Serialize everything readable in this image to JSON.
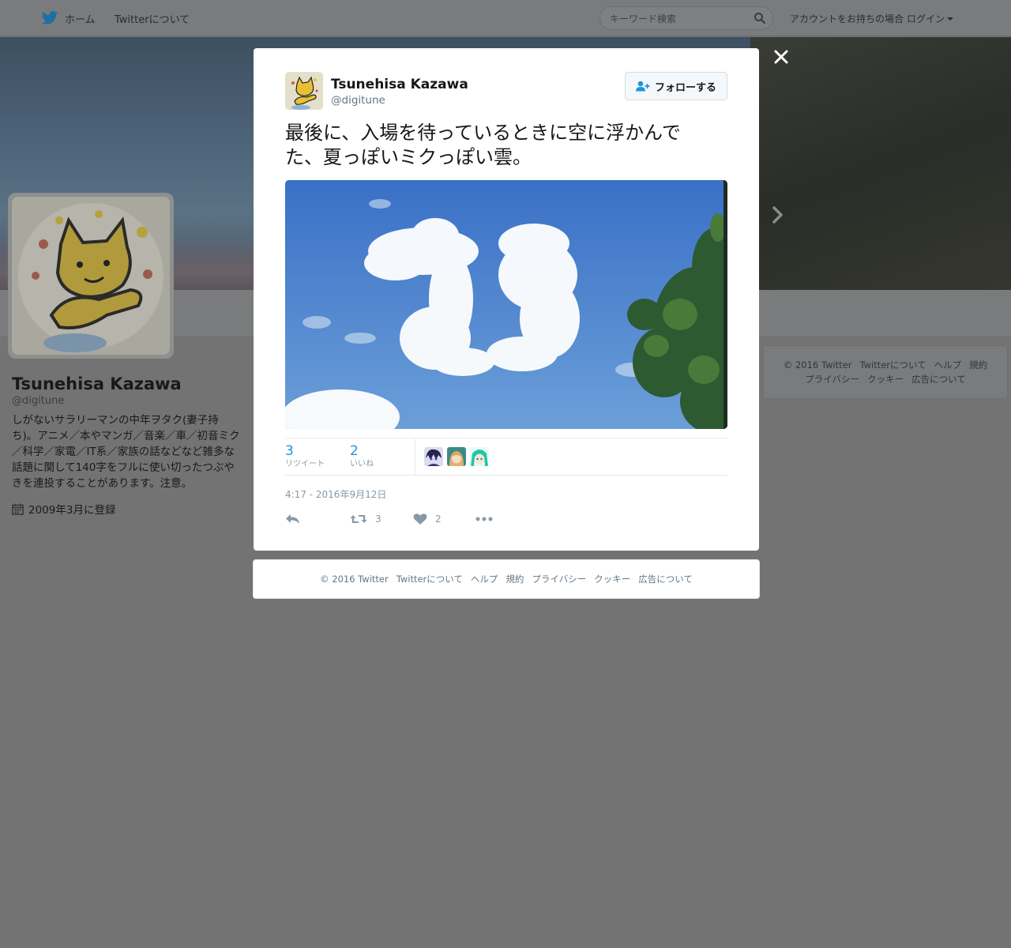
{
  "nav": {
    "home": "ホーム",
    "about": "Twitterについて",
    "search_placeholder": "キーワード検索",
    "login_prefix": "アカウントをお持ちの場合",
    "login": "ログイン"
  },
  "profile": {
    "name": "Tsunehisa Kazawa",
    "handle": "@digitune",
    "bio": "しがないサラリーマンの中年ヲタク(妻子持ち)。アニメ／本やマンガ／音楽／車／初音ミク／科学／家電／IT系／家族の話などなど雑多な話題に関して140字をフルに使い切ったつぶやきを連投することがあります。注意。",
    "joined": "2009年3月に登録"
  },
  "right_footer": {
    "links": [
      "© 2016 Twitter",
      "Twitterについて",
      "ヘルプ",
      "規約",
      "プライバシー",
      "クッキー",
      "広告について"
    ]
  },
  "tweet": {
    "name": "Tsunehisa Kazawa",
    "handle": "@digitune",
    "follow_label": "フォローする",
    "text": "最後に、入場を待っているときに空に浮かんでた、夏っぽいミクっぽい雲。",
    "retweets": "3",
    "retweets_label": "リツイート",
    "likes": "2",
    "likes_label": "いいね",
    "timestamp": "4:17 - 2016年9月12日",
    "action_retweet_count": "3",
    "action_like_count": "2"
  },
  "modal_footer": {
    "links": [
      "© 2016 Twitter",
      "Twitterについて",
      "ヘルプ",
      "規約",
      "プライバシー",
      "クッキー",
      "広告について"
    ]
  },
  "colors": {
    "accent": "#1b95e0",
    "muted": "#8899a6",
    "overlay": "#737373"
  },
  "icons": {
    "logo": "twitter-bird-icon",
    "search": "search-icon",
    "close": "close-icon",
    "next": "chevron-right-icon",
    "calendar": "calendar-icon",
    "follow": "follow-user-icon",
    "reply": "reply-icon",
    "retweet": "retweet-icon",
    "like": "heart-icon",
    "more": "more-icon"
  }
}
